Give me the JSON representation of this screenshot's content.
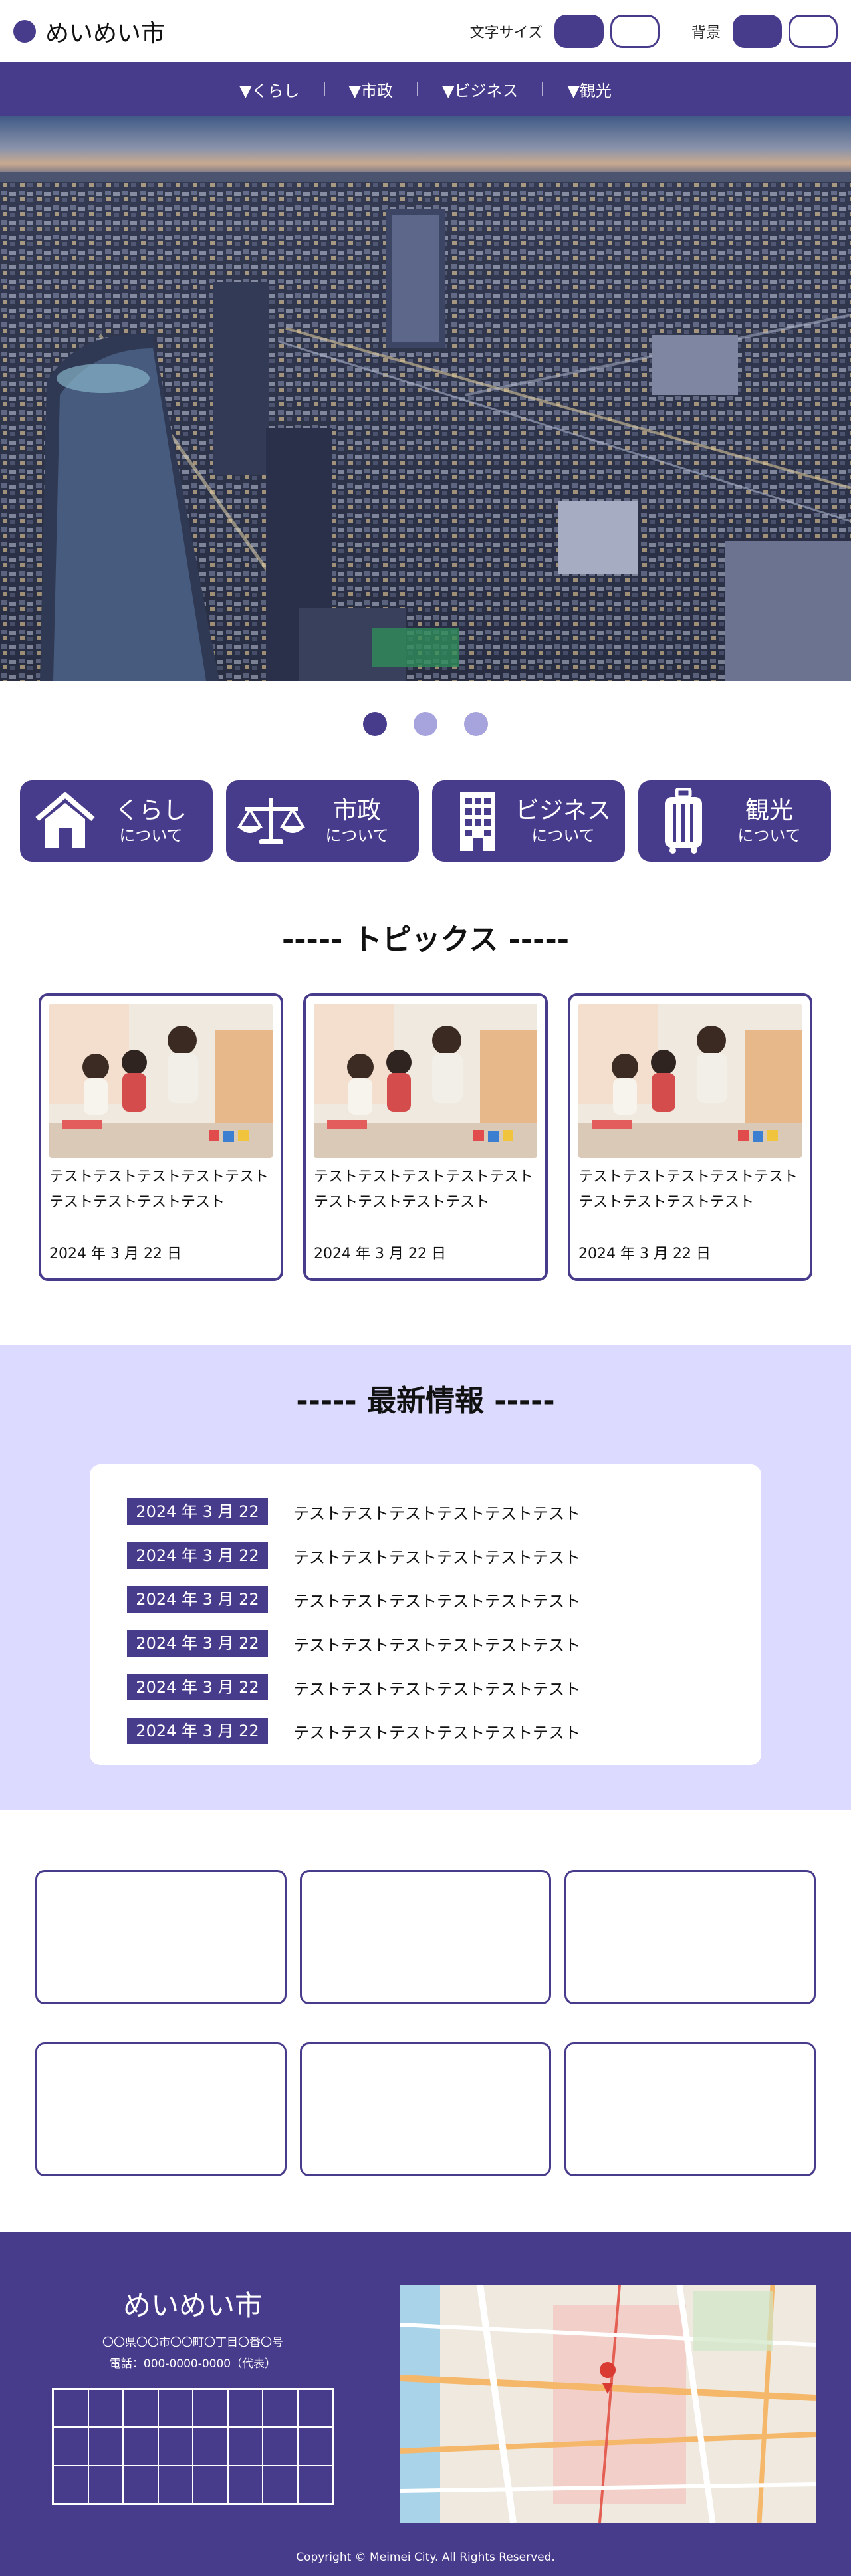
{
  "header": {
    "site_name": "めいめい市",
    "font_size_label": "文字サイズ",
    "background_label": "背景"
  },
  "nav": {
    "items": [
      "▼くらし",
      "▼市政",
      "▼ビジネス",
      "▼観光"
    ]
  },
  "carousel": {
    "slide_count": 3,
    "active_index": 0
  },
  "categories": [
    {
      "title": "くらし",
      "sub": "について",
      "icon": "house-icon"
    },
    {
      "title": "市政",
      "sub": "について",
      "icon": "scales-icon"
    },
    {
      "title": "ビジネス",
      "sub": "について",
      "icon": "building-icon"
    },
    {
      "title": "観光",
      "sub": "について",
      "icon": "suitcase-icon"
    }
  ],
  "topics": {
    "title": "----- トピックス -----",
    "cards": [
      {
        "text": "テストテストテストテストテストテストテストテストテスト",
        "date": "2024 年 3 月 22 日"
      },
      {
        "text": "テストテストテストテストテストテストテストテストテスト",
        "date": "2024 年 3 月 22 日"
      },
      {
        "text": "テストテストテストテストテストテストテストテストテスト",
        "date": "2024 年 3 月 22 日"
      }
    ]
  },
  "news": {
    "title": "----- 最新情報 -----",
    "items": [
      {
        "date": "2024 年 3 月 22 日",
        "text": "テストテストテストテストテストテスト"
      },
      {
        "date": "2024 年 3 月 22 日",
        "text": "テストテストテストテストテストテスト"
      },
      {
        "date": "2024 年 3 月 22 日",
        "text": "テストテストテストテストテストテスト"
      },
      {
        "date": "2024 年 3 月 22 日",
        "text": "テストテストテストテストテストテスト"
      },
      {
        "date": "2024 年 3 月 22 日",
        "text": "テストテストテストテストテストテスト"
      },
      {
        "date": "2024 年 3 月 22 日",
        "text": "テストテストテストテストテストテスト"
      }
    ]
  },
  "footer": {
    "name": "めいめい市",
    "address": "〇〇県〇〇市〇〇町〇丁目〇番〇号",
    "tel": "電話：000-0000-0000（代表）",
    "copyright": "Copyright © Meimei City. All Rights Reserved."
  },
  "colors": {
    "brand": "#473b8c",
    "light_band": "#dcdaff"
  }
}
